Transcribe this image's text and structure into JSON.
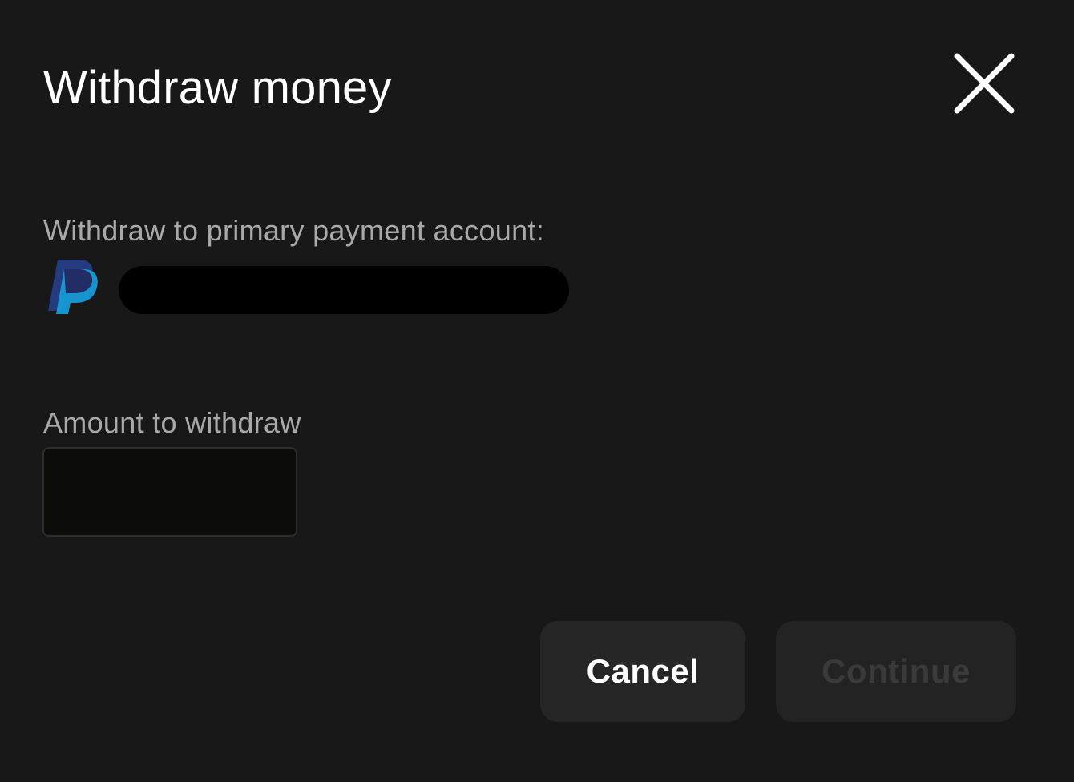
{
  "dialog": {
    "title": "Withdraw money",
    "close_icon": "close-icon"
  },
  "account": {
    "label": "Withdraw to primary payment account:",
    "provider_icon": "paypal-logo-icon",
    "colors": {
      "paypal_dark": "#253B80",
      "paypal_light": "#179BD7"
    }
  },
  "amount": {
    "label": "Amount to withdraw",
    "value": ""
  },
  "buttons": {
    "cancel_label": "Cancel",
    "continue_label": "Continue",
    "continue_disabled": true
  },
  "colors": {
    "background": "#181818",
    "muted_text": "#a9a9a9",
    "button_bg": "#262626",
    "disabled_text": "#3a3a3a"
  }
}
